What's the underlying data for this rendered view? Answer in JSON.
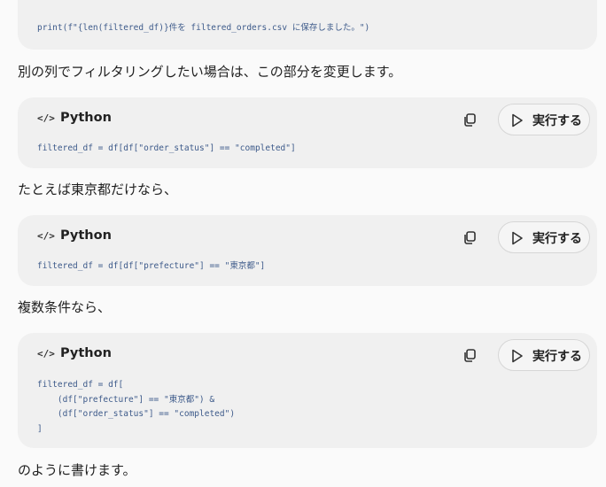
{
  "blocks": [
    {
      "code": "print(f\"{len(filtered_df)}件を filtered_orders.csv に保存しました。\")"
    },
    {
      "lang": "Python",
      "lang_icon": "</>",
      "run_label": "実行する",
      "copy_icon": "copy-icon",
      "code": "filtered_df = df[df[\"order_status\"] == \"completed\"]"
    },
    {
      "lang": "Python",
      "lang_icon": "</>",
      "run_label": "実行する",
      "copy_icon": "copy-icon",
      "code": "filtered_df = df[df[\"prefecture\"] == \"東京都\"]"
    },
    {
      "lang": "Python",
      "lang_icon": "</>",
      "run_label": "実行する",
      "copy_icon": "copy-icon",
      "code_lines": [
        "filtered_df = df[",
        "    (df[\"prefecture\"] == \"東京都\") &",
        "    (df[\"order_status\"] == \"completed\")",
        "]"
      ]
    }
  ],
  "prose": {
    "p1": "別の列でフィルタリングしたい場合は、この部分を変更します。",
    "p2": "たとえば東京都だけなら、",
    "p3": "複数条件なら、",
    "p4": "のように書けます。"
  }
}
